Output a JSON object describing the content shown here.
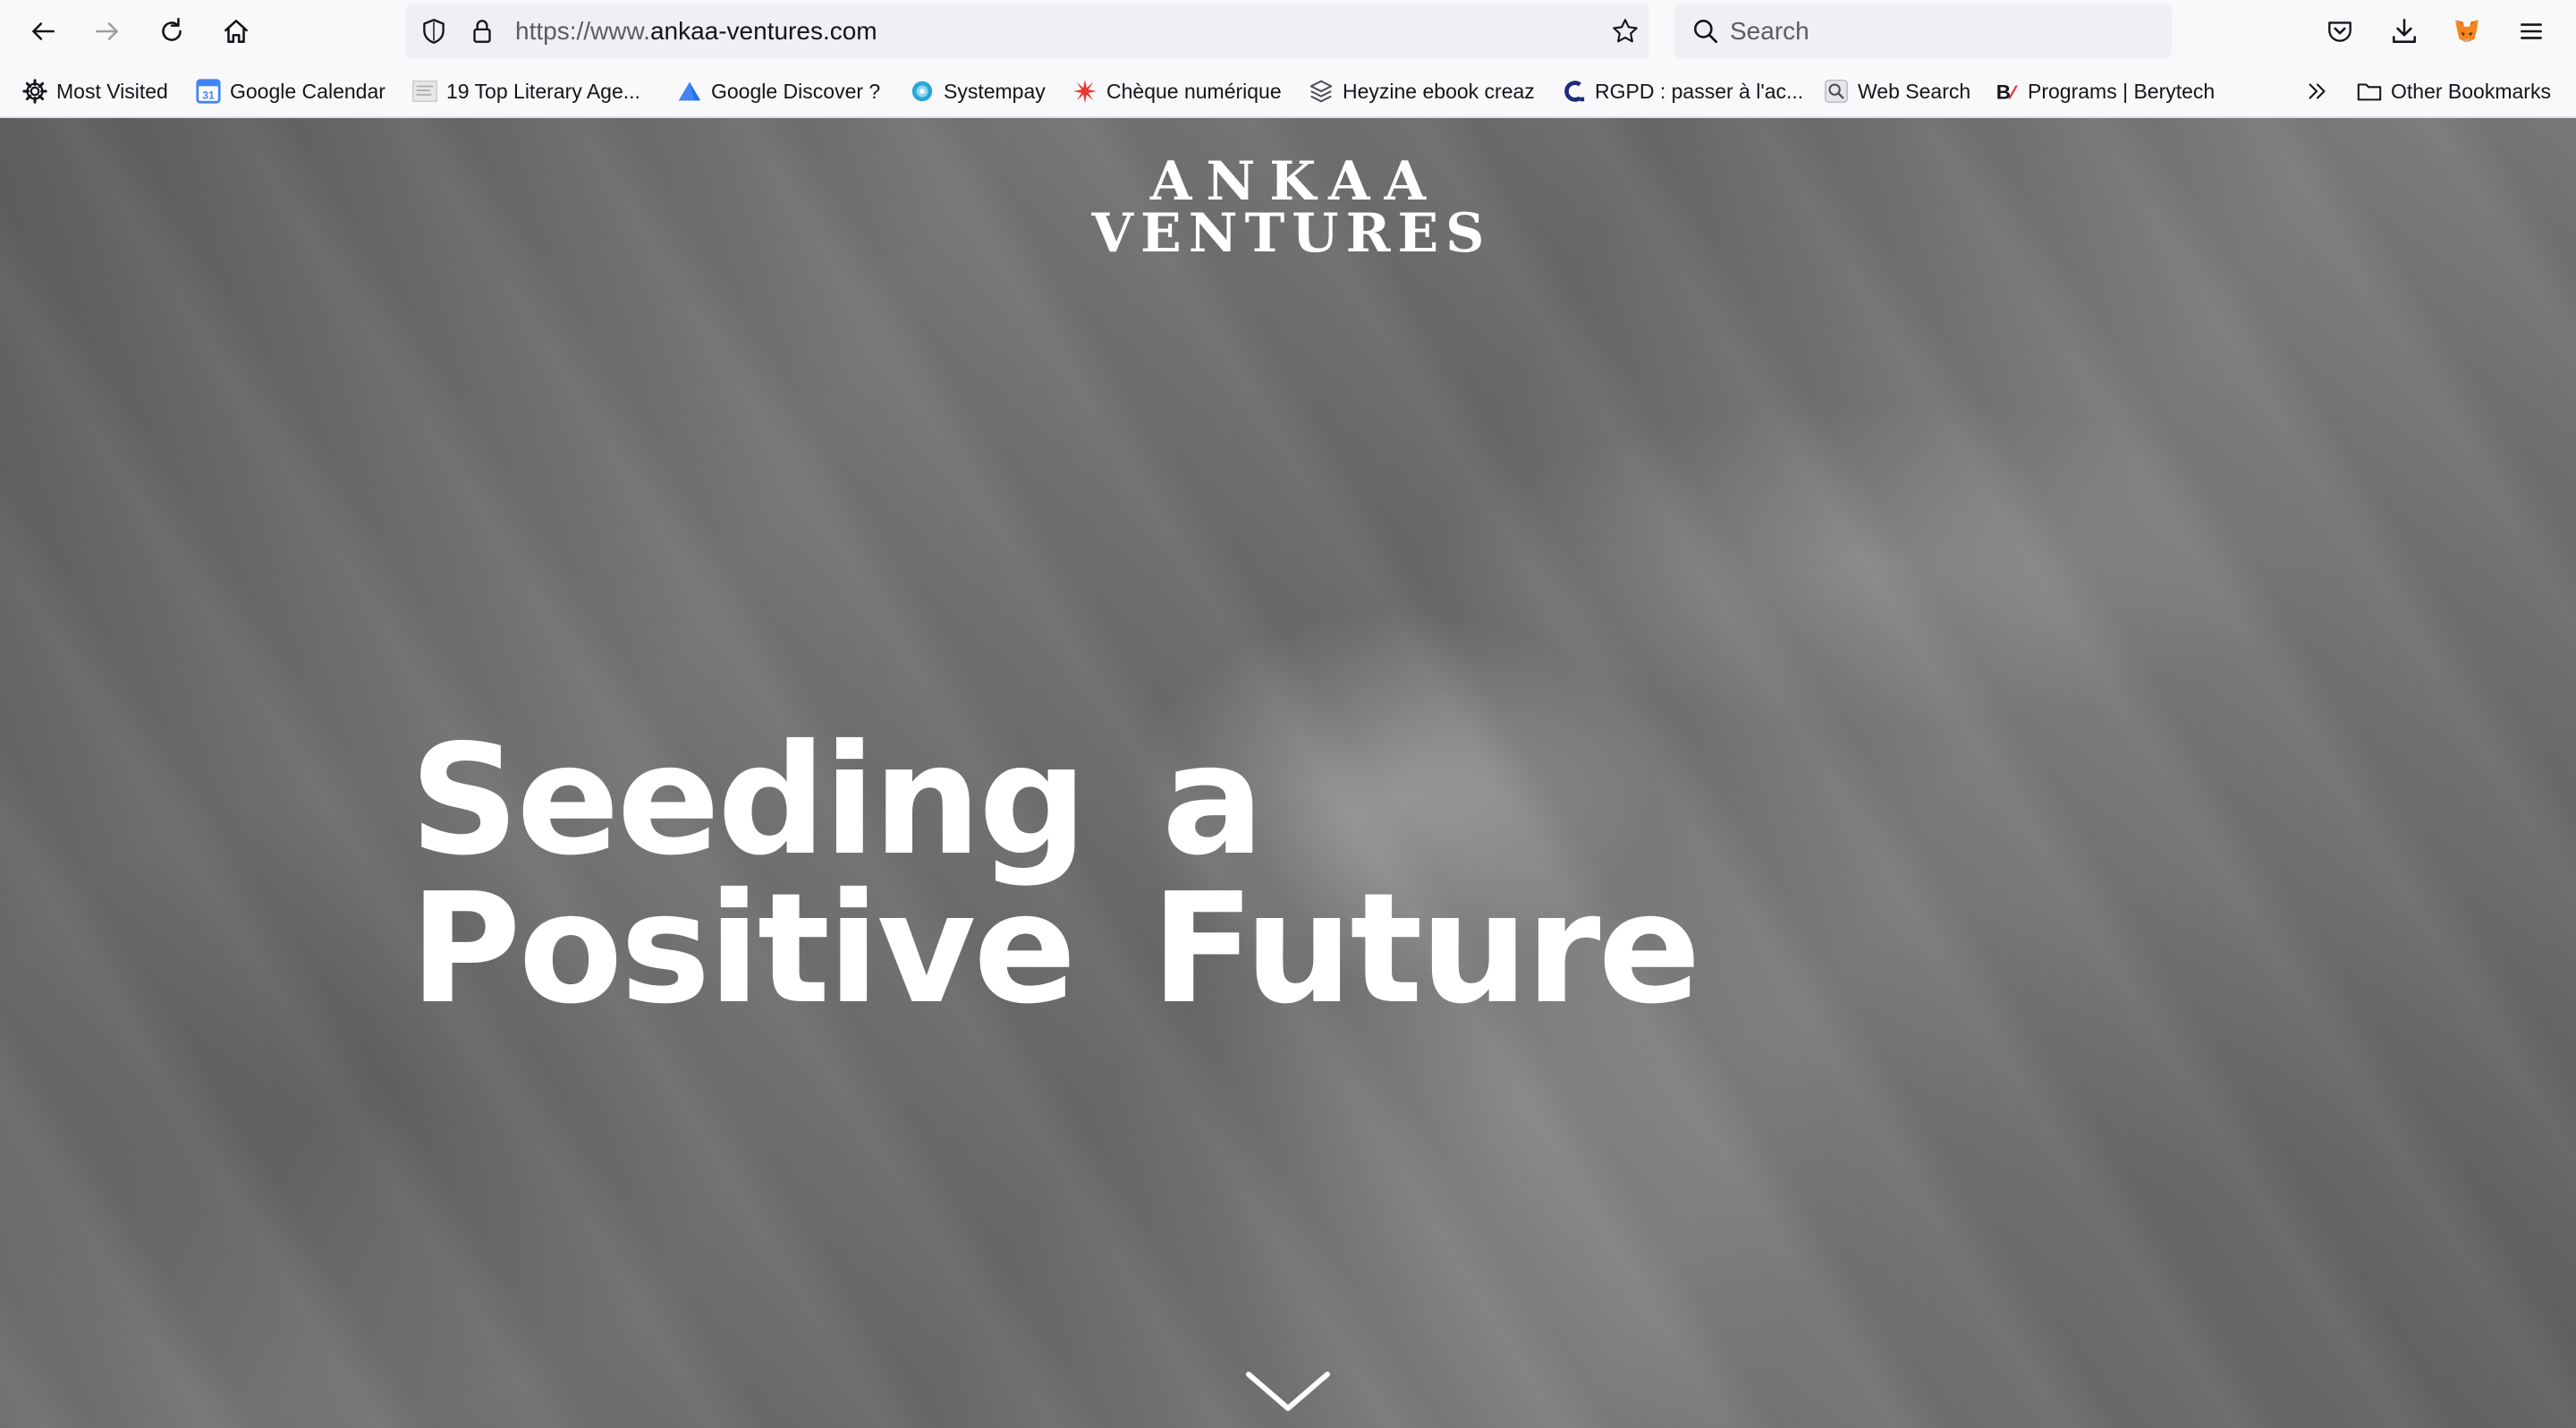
{
  "browser": {
    "url": {
      "scheme_prefix": "https://www.",
      "domain": "ankaa-ventures.com"
    },
    "search_placeholder": "Search",
    "toolbar_icons": [
      "back-arrow-icon",
      "forward-arrow-icon",
      "reload-icon",
      "home-icon",
      "shield-icon",
      "lock-icon",
      "bookmark-star-icon",
      "search-icon",
      "pocket-icon",
      "download-icon",
      "metamask-fox-icon",
      "hamburger-menu-icon"
    ],
    "bookmarks": [
      {
        "label": "Most Visited",
        "icon": "gear-icon"
      },
      {
        "label": "Google Calendar",
        "icon": "calendar-icon"
      },
      {
        "label": "19 Top Literary Age...",
        "icon": "page-thumbnail-icon"
      },
      {
        "label": "Google Discover ?",
        "icon": "triangle-icon"
      },
      {
        "label": "Systempay",
        "icon": "globe-icon"
      },
      {
        "label": "Chèque numérique",
        "icon": "starburst-icon"
      },
      {
        "label": "Heyzine ebook creaz",
        "icon": "layers-icon"
      },
      {
        "label": "RGPD : passer à l'ac...",
        "icon": "c-logo-icon"
      },
      {
        "label": "Web Search",
        "icon": "search-box-icon"
      },
      {
        "label": "Programs | Berytech",
        "icon": "b-logo-icon"
      }
    ],
    "other_bookmarks_label": "Other Bookmarks"
  },
  "page": {
    "logo": {
      "line1": "ANKAA",
      "line2": "VENTURES"
    },
    "headline": {
      "line1": "Seeding a",
      "line2": "Positive Future"
    },
    "scroll_icon": "chevron-down-icon"
  },
  "colors": {
    "chrome_bg": "#f9f9fb",
    "urlbar_bg": "#f0f0f4",
    "hero_base": "#6b6b6b",
    "hero_text": "#ffffff",
    "calendar_blue": "#4285f4",
    "discover_blue": "#1a73e8",
    "starburst_red": "#e53935",
    "rgpd_navy": "#1f2a7a",
    "metamask_orange": "#e2761b"
  }
}
